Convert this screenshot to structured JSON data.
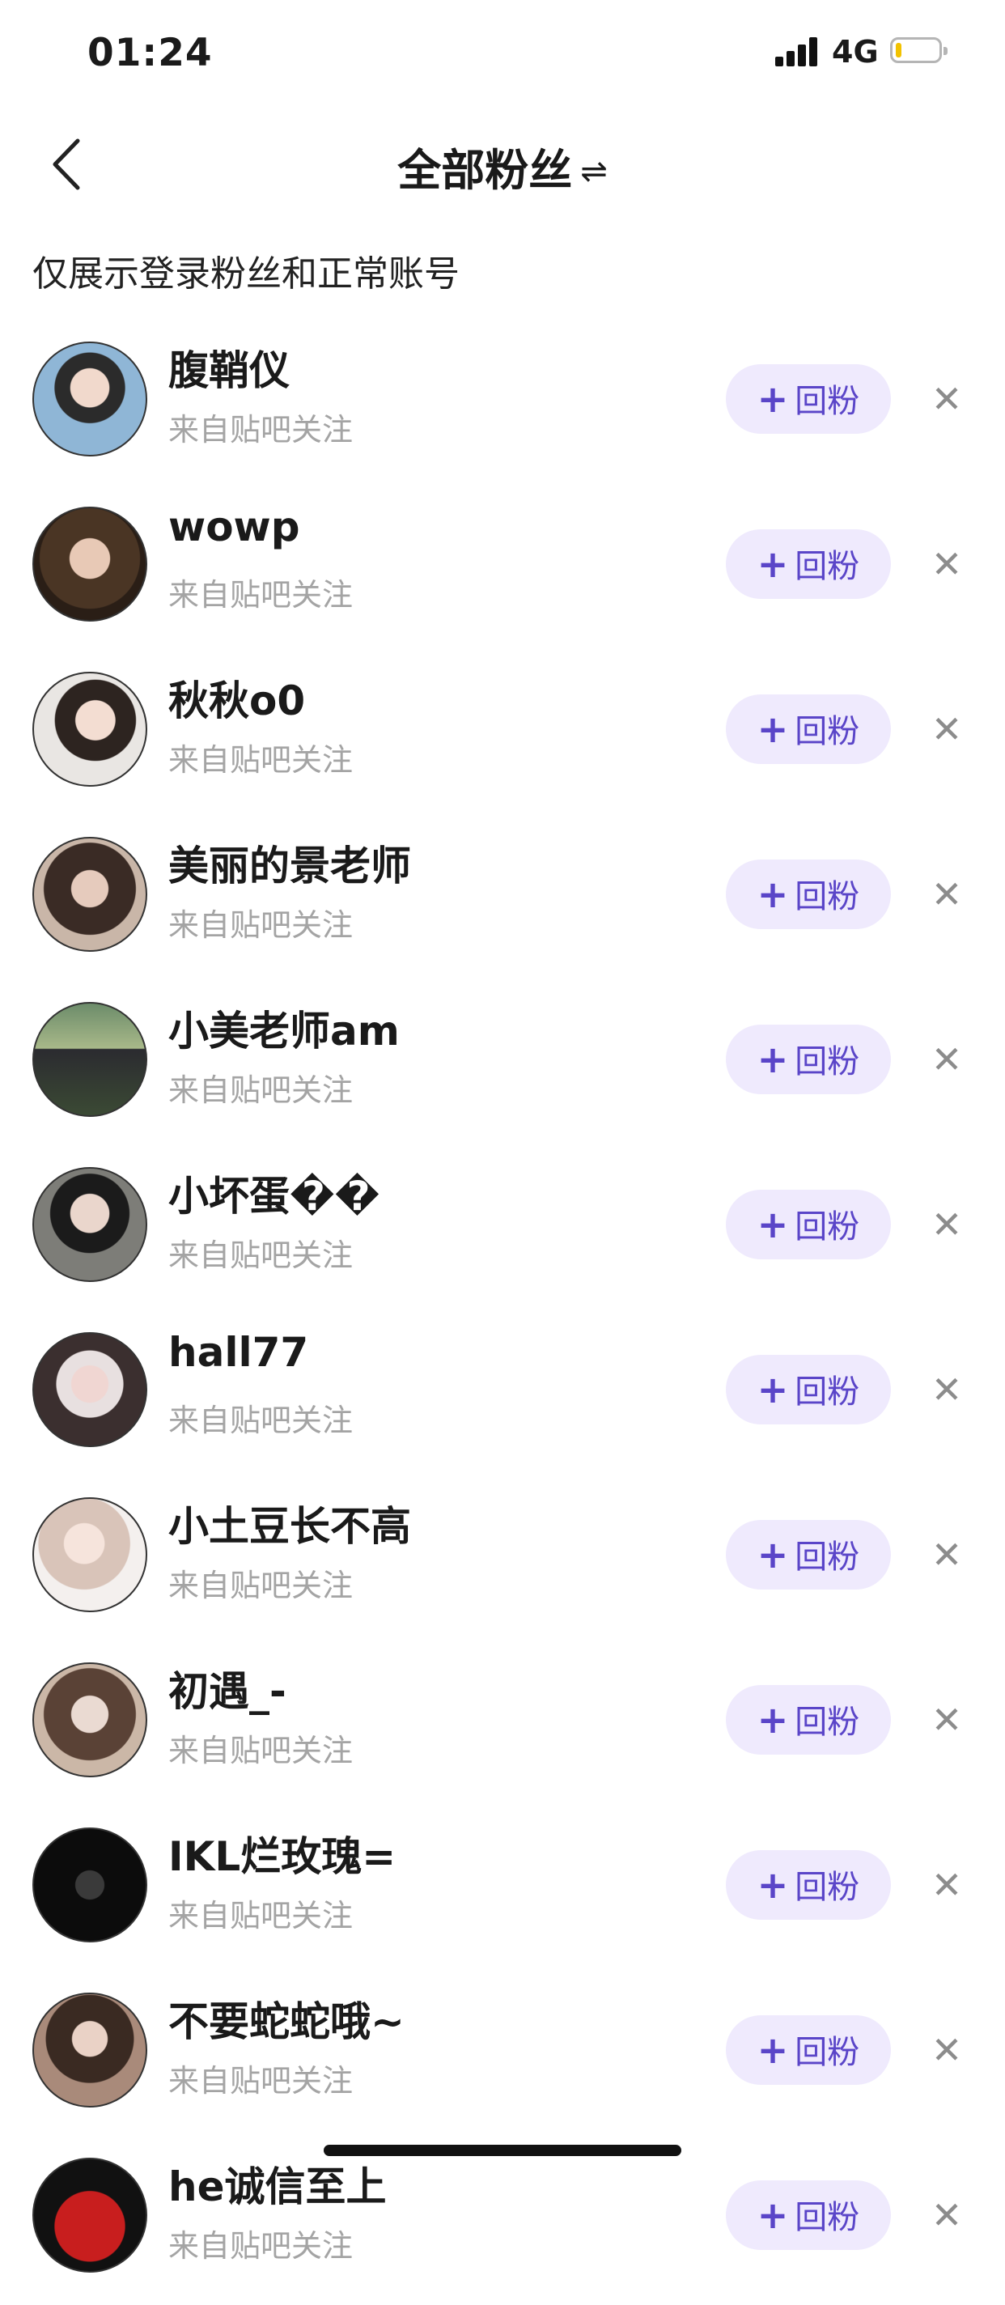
{
  "status_bar": {
    "time": "01:24",
    "network": "4G"
  },
  "header": {
    "title": "全部粉丝",
    "swap_icon": "⇌"
  },
  "notice": "仅展示登录粉丝和正常账号",
  "follow_back_label": "回粉",
  "follow_back_plus": "+",
  "remove_label": "✕",
  "colors": {
    "accent": "#5a45c8",
    "button_bg": "#efeafd",
    "secondary_text": "#a4a4a4"
  },
  "followers": [
    {
      "name": "腹鞘仪",
      "source": "来自贴吧关注"
    },
    {
      "name": "wowp",
      "source": "来自贴吧关注"
    },
    {
      "name": "秋秋o0",
      "source": "来自贴吧关注"
    },
    {
      "name": "美丽的景老师",
      "source": "来自贴吧关注"
    },
    {
      "name": "小美老师am",
      "source": "来自贴吧关注"
    },
    {
      "name": "小坏蛋��",
      "source": "来自贴吧关注"
    },
    {
      "name": "hall77",
      "source": "来自贴吧关注"
    },
    {
      "name": "小土豆长不高",
      "source": "来自贴吧关注"
    },
    {
      "name": "初遇_-",
      "source": "来自贴吧关注"
    },
    {
      "name": "IKL烂玫瑰=",
      "source": "来自贴吧关注"
    },
    {
      "name": "不要蛇蛇哦~",
      "source": "来自贴吧关注"
    },
    {
      "name": "he诚信至上",
      "source": "来自贴吧关注"
    }
  ]
}
